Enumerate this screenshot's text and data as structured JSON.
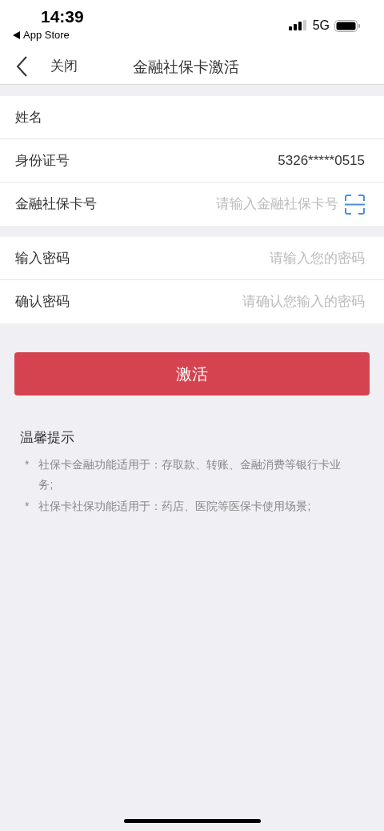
{
  "status_bar": {
    "time": "14:39",
    "back_app": "App Store",
    "network": "5G"
  },
  "nav": {
    "close": "关闭",
    "title": "金融社保卡激活"
  },
  "groups": [
    {
      "rows": [
        {
          "kind": "text",
          "label": "姓名"
        },
        {
          "kind": "value",
          "label": "身份证号",
          "value": "5326*****0515"
        },
        {
          "kind": "scan",
          "label": "金融社保卡号",
          "placeholder": "请输入金融社保卡号"
        }
      ]
    },
    {
      "rows": [
        {
          "kind": "input",
          "label": "输入密码",
          "placeholder": "请输入您的密码"
        },
        {
          "kind": "input",
          "label": "确认密码",
          "placeholder": "请确认您输入的密码"
        }
      ]
    }
  ],
  "submit_button": "激活",
  "tips": {
    "title": "温馨提示",
    "items": [
      {
        "marker": "*",
        "text": "社保卡金融功能适用于：存取款、转账、金融消费等银行卡业务;"
      },
      {
        "marker": "*",
        "text": "社保卡社保功能适用于：药店、医院等医保卡使用场景;"
      }
    ]
  }
}
